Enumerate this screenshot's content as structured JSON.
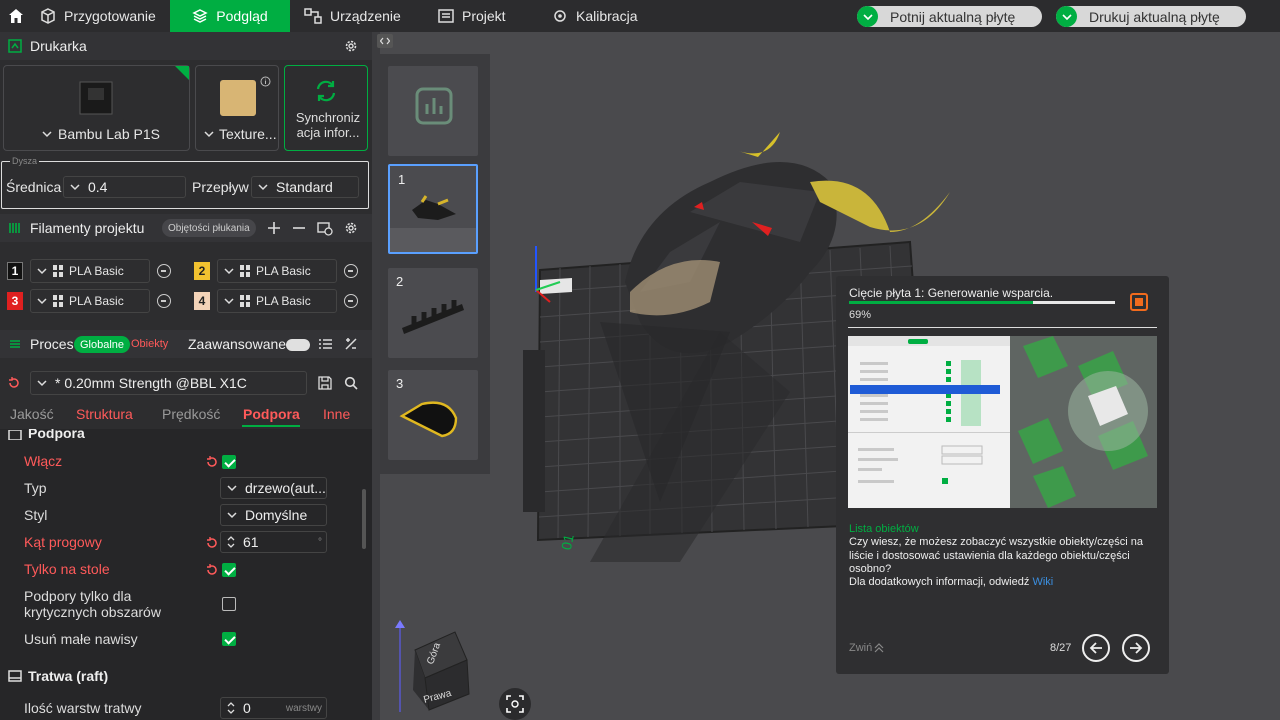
{
  "topbar": {
    "tabs": [
      {
        "label": "Przygotowanie"
      },
      {
        "label": "Podgląd"
      },
      {
        "label": "Urządzenie"
      },
      {
        "label": "Projekt"
      },
      {
        "label": "Kalibracja"
      }
    ],
    "actions": {
      "slice": "Potnij aktualną płytę",
      "print": "Drukuj aktualną płytę"
    }
  },
  "printer": {
    "title": "Drukarka",
    "model": "Bambu Lab P1S",
    "plate": "Texture...",
    "sync": "Synchroniz acja infor...",
    "nozzle_group": "Dysza",
    "diameter_label": "Średnica",
    "diameter": "0.4",
    "flow_label": "Przepływ",
    "flow": "Standard"
  },
  "filaments": {
    "title": "Filamenty projektu",
    "flush_btn": "Objętości płukania",
    "items": [
      {
        "num": "1",
        "name": "PLA Basic",
        "color": "#111111",
        "text": "#ffffff"
      },
      {
        "num": "2",
        "name": "PLA Basic",
        "color": "#f2c230",
        "text": "#222222"
      },
      {
        "num": "3",
        "name": "PLA Basic",
        "color": "#e02020",
        "text": "#ffffff"
      },
      {
        "num": "4",
        "name": "PLA Basic",
        "color": "#f3d3b8",
        "text": "#222222"
      }
    ]
  },
  "process": {
    "title": "Proces",
    "global": "Globalne",
    "objects": "Obiekty",
    "advanced": "Zaawansowane",
    "preset": "* 0.20mm Strength @BBL X1C",
    "tabs": [
      "Jakość",
      "Struktura",
      "Prędkość",
      "Podpora",
      "Inne"
    ],
    "section": "Podpora",
    "params": {
      "enable": "Włącz",
      "type": "Typ",
      "type_val": "drzewo(aut...",
      "style": "Styl",
      "style_val": "Domyślne",
      "angle": "Kąt progowy",
      "angle_val": "61",
      "angle_unit": "°",
      "on_plate": "Tylko na stole",
      "critical": "Podpory tylko dla krytycznych obszarów",
      "remove_small": "Usuń małe nawisy"
    },
    "raft_title": "Tratwa (raft)",
    "raft_layers": "Ilość warstw tratwy",
    "raft_val": "0",
    "raft_unit": "warstwy"
  },
  "plates": [
    {
      "n": "1"
    },
    {
      "n": "2"
    },
    {
      "n": "3"
    }
  ],
  "viewport": {
    "plate_label": "01",
    "cube_top": "Góra",
    "cube_right": "Prawa"
  },
  "popup": {
    "status": "Cięcie płyta 1: Generowanie wsparcia.",
    "progress": 0.69,
    "progress_text": "69%",
    "heading": "Lista obiektów",
    "body": "Czy wiesz, że możesz zobaczyć wszystkie obiekty/części na liście i dostosować ustawienia dla każdego obiektu/części osobno?",
    "more": "Dla dodatkowych informacji, odwiedź",
    "link": "Wiki",
    "collapse": "Zwiń",
    "page": "8/27"
  },
  "colors": {
    "accent": "#00ae42",
    "warn": "#ff5a5a",
    "link": "#3b8fe0"
  }
}
